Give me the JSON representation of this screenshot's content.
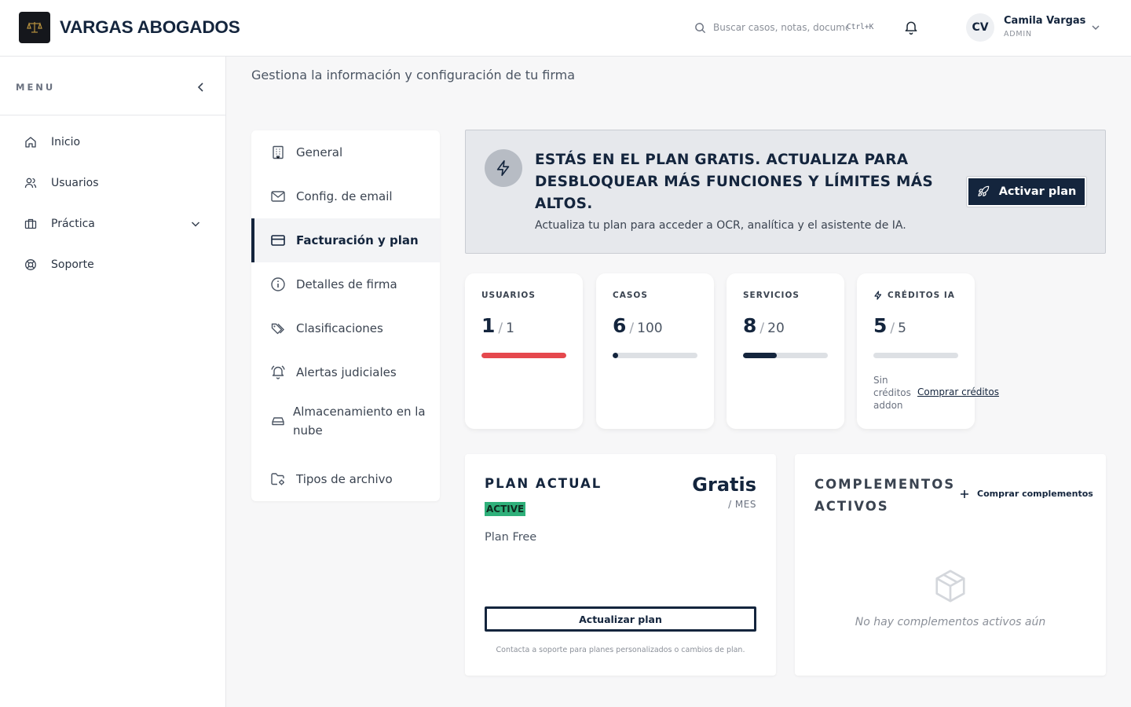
{
  "header": {
    "brand": "VARGAS ABOGADOS",
    "search_placeholder": "Buscar casos, notas, documentos...",
    "search_shortcut": "Ctrl+K",
    "user": {
      "initials": "CV",
      "name": "Camila Vargas",
      "role": "ADMIN"
    }
  },
  "sidebar": {
    "menu_label": "MENU",
    "items": [
      {
        "label": "Inicio",
        "icon": "home-icon"
      },
      {
        "label": "Usuarios",
        "icon": "users-icon"
      },
      {
        "label": "Práctica",
        "icon": "briefcase-icon"
      },
      {
        "label": "Soporte",
        "icon": "lifebuoy-icon"
      }
    ]
  },
  "page": {
    "subtitle": "Gestiona la información y configuración de tu firma"
  },
  "settings_menu": {
    "items": [
      {
        "label": "General",
        "icon": "building-icon"
      },
      {
        "label": "Config. de email",
        "icon": "mail-icon"
      },
      {
        "label": "Facturación y plan",
        "icon": "credit-card-icon",
        "active": true
      },
      {
        "label": "Detalles de firma",
        "icon": "info-icon"
      },
      {
        "label": "Clasificaciones",
        "icon": "tags-icon"
      },
      {
        "label": "Alertas judiciales",
        "icon": "bell-ring-icon"
      },
      {
        "label": "Almacenamiento en la nube",
        "icon": "hard-drive-icon"
      },
      {
        "label": "Tipos de archivo",
        "icon": "folder-cog-icon"
      }
    ]
  },
  "banner": {
    "title": "ESTÁS EN EL PLAN GRATIS. ACTUALIZA PARA DESBLOQUEAR MÁS FUNCIONES Y LÍMITES MÁS ALTOS.",
    "description": "Actualiza tu plan para acceder a OCR, analítica y el asistente de IA.",
    "button": "Activar plan"
  },
  "stats": [
    {
      "label": "USUARIOS",
      "value": "1",
      "limit": "1",
      "usage": 1.0,
      "color": "#e5484d"
    },
    {
      "label": "CASOS",
      "value": "6",
      "limit": "100",
      "usage": 0.06,
      "color": "#14253d"
    },
    {
      "label": "SERVICIOS",
      "value": "8",
      "limit": "20",
      "usage": 0.4,
      "color": "#14253d"
    },
    {
      "label": "CRÉDITOS IA",
      "value": "5",
      "limit": "5",
      "usage": 0,
      "color": "#14253d",
      "note": "Sin créditos addon",
      "link": "Comprar créditos"
    }
  ],
  "plan": {
    "title": "PLAN ACTUAL",
    "status": "ACTIVE",
    "price": "Gratis",
    "period": "/ MES",
    "name": "Plan Free",
    "button": "Actualizar plan",
    "footer": "Contacta a soporte para planes personalizados o cambios de plan."
  },
  "complements": {
    "title": "COMPLEMENTOS ACTIVOS",
    "buy": "Comprar complementos",
    "empty": "No hay complementos activos aún"
  },
  "colors": {
    "primary": "#14253d",
    "danger": "#e5484d",
    "success": "#2fb07a",
    "banner_bg": "#e6e8ec"
  }
}
